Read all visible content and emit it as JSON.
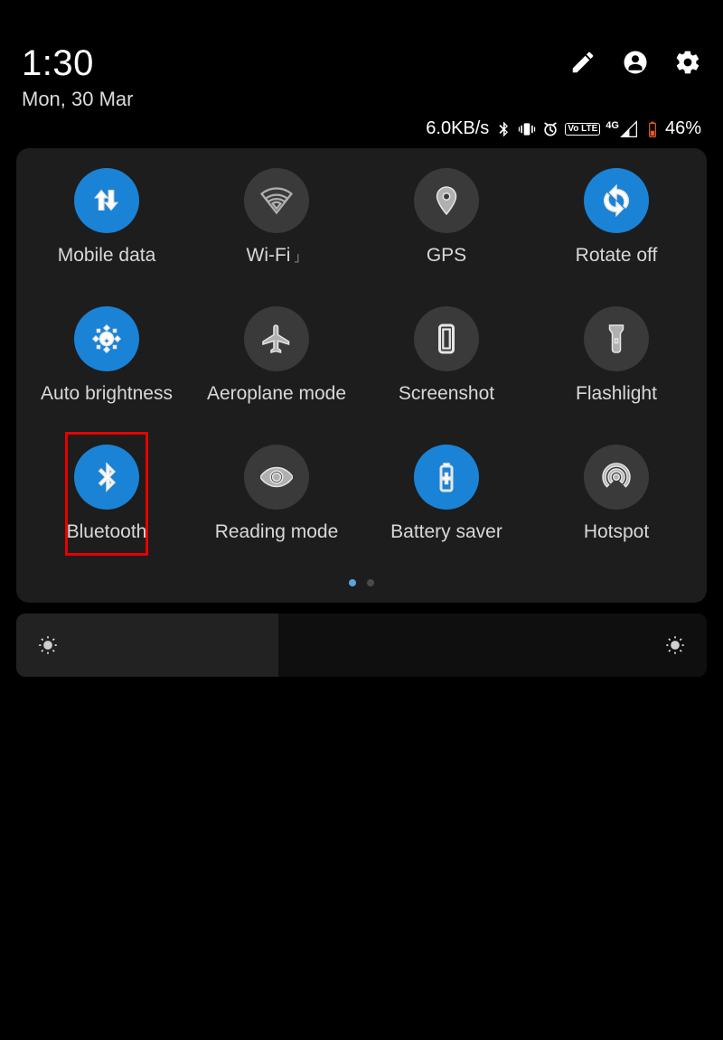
{
  "status": {
    "time": "1:30",
    "date": "Mon, 30 Mar",
    "net_speed": "6.0KB/s",
    "net_type": "4G",
    "volte": "Vo LTE",
    "battery_pct": "46%"
  },
  "tiles": [
    {
      "label": "Mobile data",
      "active": true,
      "icon": "mobile-data",
      "highlight": false
    },
    {
      "label": "Wi-Fi",
      "active": false,
      "icon": "wifi",
      "highlight": false,
      "sub": "」"
    },
    {
      "label": "GPS",
      "active": false,
      "icon": "gps",
      "highlight": false
    },
    {
      "label": "Rotate off",
      "active": true,
      "icon": "rotate",
      "highlight": false
    },
    {
      "label": "Auto brightness",
      "active": true,
      "icon": "brightness",
      "highlight": false
    },
    {
      "label": "Aeroplane mode",
      "active": false,
      "icon": "airplane",
      "highlight": false
    },
    {
      "label": "Screenshot",
      "active": false,
      "icon": "screenshot",
      "highlight": false
    },
    {
      "label": "Flashlight",
      "active": false,
      "icon": "flashlight",
      "highlight": false
    },
    {
      "label": "Bluetooth",
      "active": true,
      "icon": "bluetooth",
      "highlight": true
    },
    {
      "label": "Reading mode",
      "active": false,
      "icon": "eye",
      "highlight": false
    },
    {
      "label": "Battery saver",
      "active": true,
      "icon": "battery",
      "highlight": false
    },
    {
      "label": "Hotspot",
      "active": false,
      "icon": "hotspot",
      "highlight": false
    }
  ],
  "pager": {
    "pages": 2,
    "current": 0
  }
}
